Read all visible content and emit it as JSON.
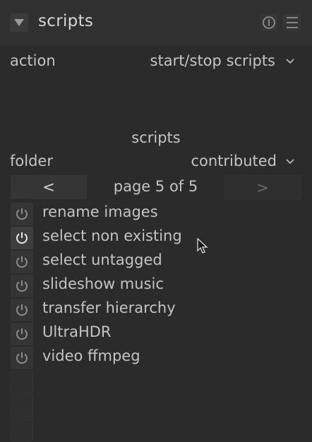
{
  "header": {
    "title": "scripts",
    "collapse_icon": "triangle-down-icon",
    "reset_icon": "reset-circle-icon",
    "presets_icon": "hamburger-menu-icon"
  },
  "action": {
    "label": "action",
    "value": "start/stop scripts"
  },
  "section_title": "scripts",
  "folder": {
    "label": "folder",
    "value": "contributed"
  },
  "pagination": {
    "prev_label": "<",
    "page_label": "page 5 of 5",
    "next_label": ">"
  },
  "scripts": [
    {
      "name": "rename images",
      "active": false
    },
    {
      "name": "select non existing",
      "active": true
    },
    {
      "name": "select untagged",
      "active": false
    },
    {
      "name": "slideshow music",
      "active": false
    },
    {
      "name": "transfer hierarchy",
      "active": false
    },
    {
      "name": "UltraHDR",
      "active": false
    },
    {
      "name": "video ffmpeg",
      "active": false
    }
  ],
  "colors": {
    "background": "#2b2b2b",
    "header_bg": "#303030",
    "text": "#c4c4c4",
    "button_bg": "#353535"
  }
}
